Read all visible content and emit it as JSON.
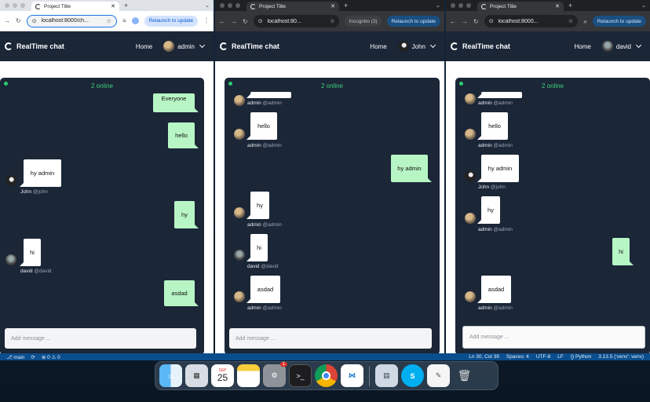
{
  "windows": [
    {
      "tab_title": "Project Title",
      "url": "localhost:8000/ch...",
      "chip": "",
      "relaunch": "Relaunch to update",
      "user": "admin"
    },
    {
      "tab_title": "Project Title",
      "url": "localhost:80...",
      "chip": "Incognito (3)",
      "relaunch": "Relaunch to update",
      "user": "John"
    },
    {
      "tab_title": "Project Title",
      "url": "localhost:8000...",
      "chip": "",
      "relaunch": "Relaunch to update",
      "user": "david"
    }
  ],
  "app": {
    "brand": "RealTime chat",
    "home": "Home",
    "online": "2  online",
    "composer_placeholder": "Add message ..."
  },
  "chat1": {
    "m1": "Everyone",
    "m2": "hello",
    "m3": "hy admin",
    "m3_user": "John",
    "m3_handle": "@john",
    "m4": "hy",
    "m5": "hi",
    "m5_user": "david",
    "m5_handle": "@david",
    "m6": "asdad"
  },
  "chat2": {
    "m0_user": "admin",
    "m0_handle": "@admin",
    "m1": "hello",
    "m1_user": "admin",
    "m1_handle": "@admin",
    "m2": "hy admin",
    "m3": "hy",
    "m3_user": "admin",
    "m3_handle": "@admin",
    "m4": "hi",
    "m4_user": "david",
    "m4_handle": "@david",
    "m5": "asdad",
    "m5_user": "admin",
    "m5_handle": "@admin"
  },
  "chat3": {
    "m0_user": "admin",
    "m0_handle": "@admin",
    "m1": "hello",
    "m1_user": "admin",
    "m1_handle": "@admin",
    "m2": "hy admin",
    "m2_user": "John",
    "m2_handle": "@john",
    "m3": "hy",
    "m3_user": "admin",
    "m3_handle": "@admin",
    "m4": "hi",
    "m5": "asdad",
    "m5_user": "admin",
    "m5_handle": "@admin"
  },
  "statusbar": {
    "branch": "main",
    "problems": "0 ⚠ 0",
    "position": "Ln 30, Col 39",
    "spaces": "Spaces: 4",
    "encoding": "UTF-8",
    "eol": "LF",
    "language": "Python",
    "interpreter": "3.13.5 ('venv': venv)"
  },
  "dock": {
    "calendar_month": "SEP",
    "calendar_day": "25",
    "settings_badge": "1"
  }
}
